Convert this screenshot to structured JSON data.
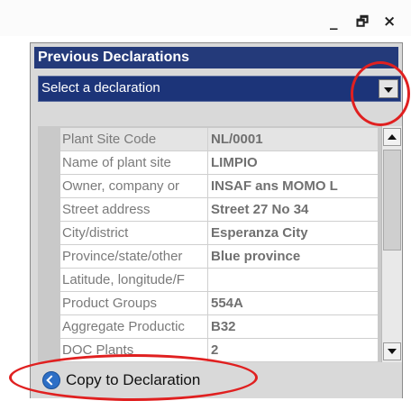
{
  "window": {
    "minimize_glyph": "_",
    "restore_glyph": "🗗",
    "close_glyph": "×"
  },
  "panel": {
    "title": "Previous Declarations"
  },
  "dropdown": {
    "selected": "Select a declaration"
  },
  "properties": {
    "rows": [
      {
        "name": "Plant Site Code",
        "value": "NL/0001"
      },
      {
        "name": "Name of plant site",
        "value": "LIMPIO"
      },
      {
        "name": "Owner, company or",
        "value": "INSAF ans MOMO L"
      },
      {
        "name": "Street address",
        "value": "Street 27 No 34"
      },
      {
        "name": "City/district",
        "value": "Esperanza City"
      },
      {
        "name": "Province/state/other",
        "value": "Blue province"
      },
      {
        "name": "Latitude, longitude/F",
        "value": ""
      },
      {
        "name": "Product Groups",
        "value": "554A"
      },
      {
        "name": "Aggregate Productic",
        "value": "B32"
      },
      {
        "name": "DOC Plants",
        "value": "2"
      }
    ]
  },
  "actions": {
    "copy_label": "Copy to Declaration"
  },
  "colors": {
    "header_bg": "#243a7a",
    "select_bg": "#1c3479",
    "highlight_ring": "#e02020",
    "copy_icon": "#2d6fc6"
  },
  "icons": {
    "copy": "arrow-circle-icon",
    "dropdown": "chevron-down-icon"
  }
}
